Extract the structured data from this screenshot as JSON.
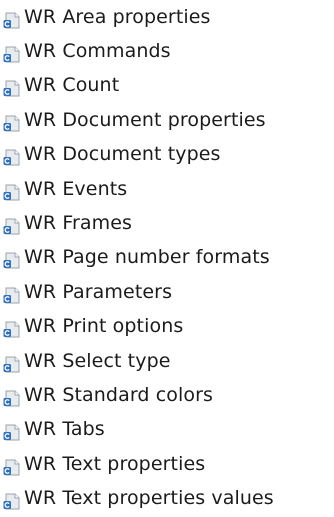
{
  "tree": {
    "items": [
      {
        "label": "WR Area properties",
        "icon": "class-document-icon"
      },
      {
        "label": "WR Commands",
        "icon": "class-document-icon"
      },
      {
        "label": "WR Count",
        "icon": "class-document-icon"
      },
      {
        "label": "WR Document properties",
        "icon": "class-document-icon"
      },
      {
        "label": "WR Document types",
        "icon": "class-document-icon"
      },
      {
        "label": "WR Events",
        "icon": "class-document-icon"
      },
      {
        "label": "WR Frames",
        "icon": "class-document-icon"
      },
      {
        "label": "WR Page number formats",
        "icon": "class-document-icon"
      },
      {
        "label": "WR Parameters",
        "icon": "class-document-icon"
      },
      {
        "label": "WR Print options",
        "icon": "class-document-icon"
      },
      {
        "label": "WR Select type",
        "icon": "class-document-icon"
      },
      {
        "label": "WR Standard colors",
        "icon": "class-document-icon"
      },
      {
        "label": "WR Tabs",
        "icon": "class-document-icon"
      },
      {
        "label": "WR Text properties",
        "icon": "class-document-icon"
      },
      {
        "label": "WR Text properties values",
        "icon": "class-document-icon"
      }
    ]
  },
  "colors": {
    "text": "#1b1b1b",
    "icon_page": "#e9ecef",
    "icon_border": "#9aa3ad",
    "icon_badge": "#2f6fbf"
  }
}
